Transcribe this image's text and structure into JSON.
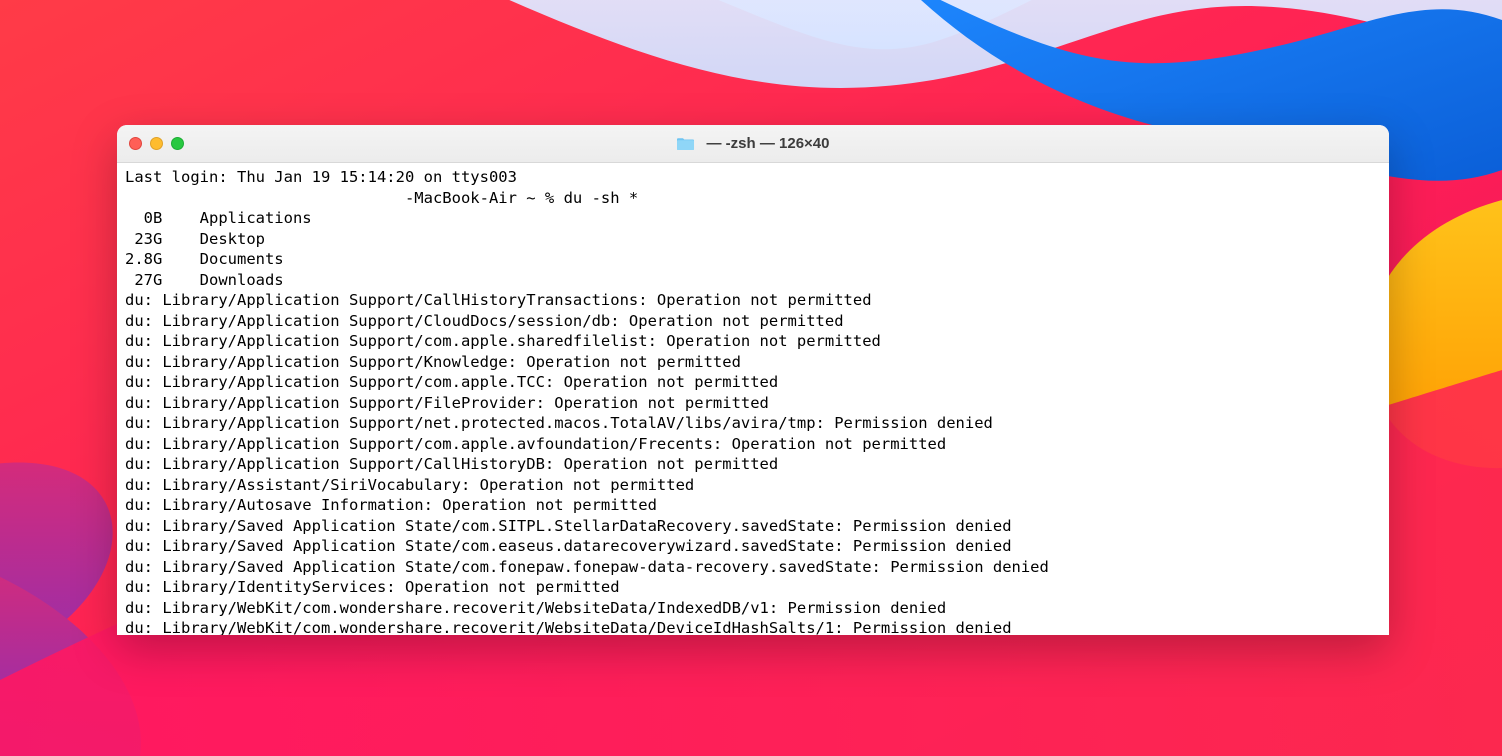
{
  "window": {
    "title_suffix": "— -zsh — 126×40",
    "folder_label": ""
  },
  "terminal": {
    "last_login": "Last login: Thu Jan 19 15:14:20 on ttys003",
    "prompt_indent": "                              ",
    "hostname_prefix": "-MacBook-Air",
    "prompt_tail": " ~ % ",
    "command": "du -sh *",
    "sizes": [
      {
        "size": "  0B",
        "name": "Applications"
      },
      {
        "size": " 23G",
        "name": "Desktop"
      },
      {
        "size": "2.8G",
        "name": "Documents"
      },
      {
        "size": " 27G",
        "name": "Downloads"
      }
    ],
    "errors": [
      "du: Library/Application Support/CallHistoryTransactions: Operation not permitted",
      "du: Library/Application Support/CloudDocs/session/db: Operation not permitted",
      "du: Library/Application Support/com.apple.sharedfilelist: Operation not permitted",
      "du: Library/Application Support/Knowledge: Operation not permitted",
      "du: Library/Application Support/com.apple.TCC: Operation not permitted",
      "du: Library/Application Support/FileProvider: Operation not permitted",
      "du: Library/Application Support/net.protected.macos.TotalAV/libs/avira/tmp: Permission denied",
      "du: Library/Application Support/com.apple.avfoundation/Frecents: Operation not permitted",
      "du: Library/Application Support/CallHistoryDB: Operation not permitted",
      "du: Library/Assistant/SiriVocabulary: Operation not permitted",
      "du: Library/Autosave Information: Operation not permitted",
      "du: Library/Saved Application State/com.SITPL.StellarDataRecovery.savedState: Permission denied",
      "du: Library/Saved Application State/com.easeus.datarecoverywizard.savedState: Permission denied",
      "du: Library/Saved Application State/com.fonepaw.fonepaw-data-recovery.savedState: Permission denied",
      "du: Library/IdentityServices: Operation not permitted",
      "du: Library/WebKit/com.wondershare.recoverit/WebsiteData/IndexedDB/v1: Permission denied",
      "du: Library/WebKit/com.wondershare.recoverit/WebsiteData/DeviceIdHashSalts/1: Permission denied"
    ]
  }
}
